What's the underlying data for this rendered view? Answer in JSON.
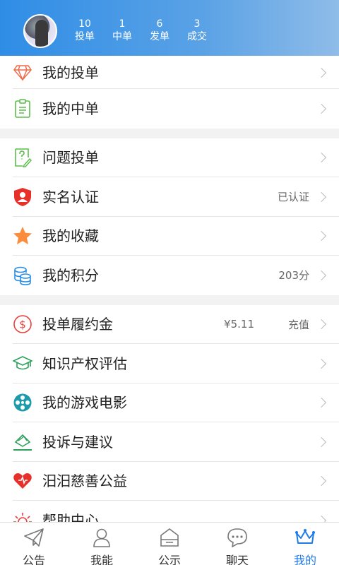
{
  "header": {
    "stats": [
      {
        "num": "10",
        "label": "投单"
      },
      {
        "num": "1",
        "label": "中单"
      },
      {
        "num": "6",
        "label": "发单"
      },
      {
        "num": "3",
        "label": "成交"
      }
    ]
  },
  "menu": {
    "group1": [
      {
        "label": "我的投单",
        "icon": "diamond-icon"
      },
      {
        "label": "我的中单",
        "icon": "clipboard-icon"
      }
    ],
    "group2": [
      {
        "label": "问题投单",
        "icon": "question-doc-icon"
      },
      {
        "label": "实名认证",
        "icon": "shield-user-icon",
        "value": "已认证"
      },
      {
        "label": "我的收藏",
        "icon": "star-icon"
      },
      {
        "label": "我的积分",
        "icon": "coins-icon",
        "value": "203分"
      }
    ],
    "group3": [
      {
        "label": "投单履约金",
        "icon": "dollar-icon",
        "amount": "¥5.11",
        "action": "充值"
      },
      {
        "label": "知识产权评估",
        "icon": "graduation-cap-icon"
      },
      {
        "label": "我的游戏电影",
        "icon": "film-reel-icon"
      },
      {
        "label": "投诉与建议",
        "icon": "envelope-icon"
      },
      {
        "label": "汨汨慈善公益",
        "icon": "heart-icon"
      },
      {
        "label": "帮助中心",
        "icon": "sun-icon"
      }
    ]
  },
  "tabs": [
    {
      "label": "公告",
      "icon": "paper-plane-icon"
    },
    {
      "label": "我能",
      "icon": "person-icon"
    },
    {
      "label": "公示",
      "icon": "house-icon"
    },
    {
      "label": "聊天",
      "icon": "chat-bubble-icon"
    },
    {
      "label": "我的",
      "icon": "crown-icon",
      "active": true
    }
  ],
  "colors": {
    "accent": "#1f7be8",
    "header_start": "#2f8de6",
    "header_end": "#8fbce8"
  }
}
